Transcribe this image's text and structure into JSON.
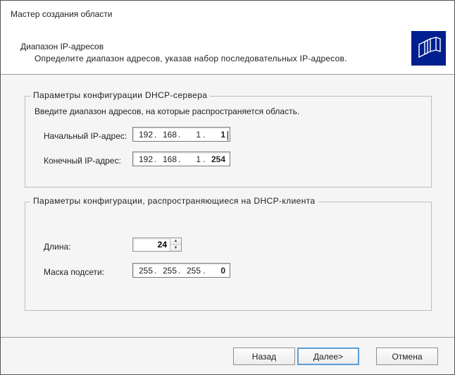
{
  "window": {
    "title": "Мастер создания области"
  },
  "page": {
    "title": "Диапазон IP-адресов",
    "description": "Определите диапазон адресов, указав набор последовательных IP-адресов."
  },
  "group_server": {
    "title": "Параметры  конфигурации  DHCP-сервера",
    "intro": "Введите диапазон адресов, на которые распространяется область.",
    "start_label": "Начальный IP-адрес:",
    "end_label": "Конечный IP-адрес:",
    "start_ip": {
      "o1": "192",
      "o2": "168",
      "o3": "1",
      "o4": "1"
    },
    "end_ip": {
      "o1": "192",
      "o2": "168",
      "o3": "1",
      "o4": "254"
    }
  },
  "group_client": {
    "title": "Параметры конфигурации, распространяющиеся на DHCP-клиента",
    "length_label": "Длина:",
    "length_value": "24",
    "mask_label": "Маска подсети:",
    "mask": {
      "o1": "255",
      "o2": "255",
      "o3": "255",
      "o4": "0"
    }
  },
  "buttons": {
    "back": "Назад",
    "next": "Далее>",
    "cancel": "Отмена"
  }
}
